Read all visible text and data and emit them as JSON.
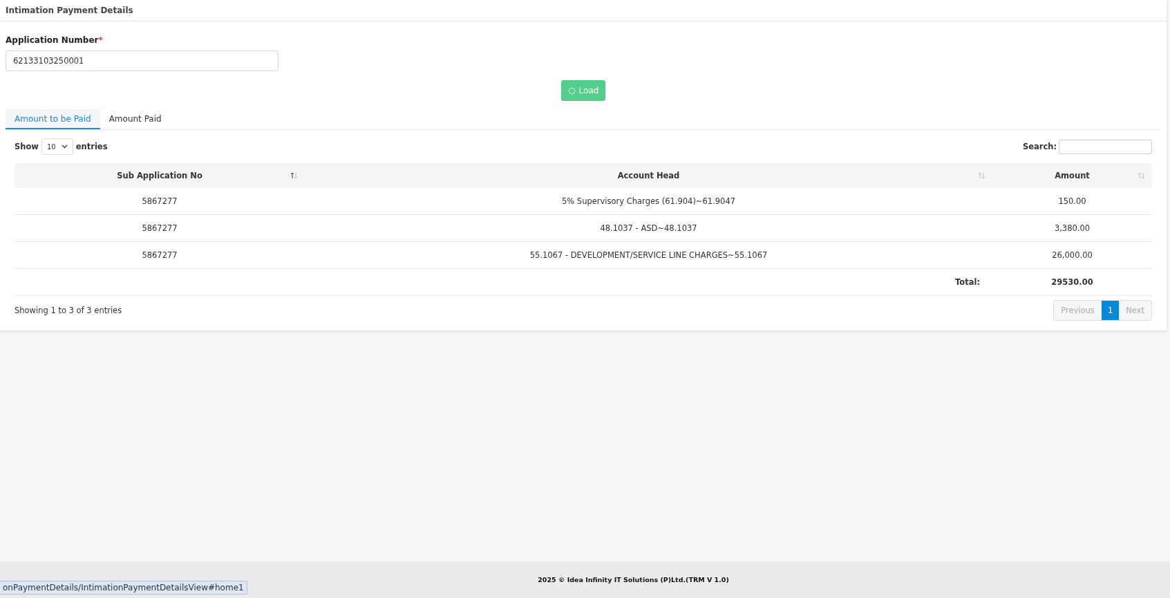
{
  "header": {
    "title": "Intimation Payment Details"
  },
  "form": {
    "label": "Application Number",
    "required_mark": "*",
    "value": "62133103250001"
  },
  "load_button": {
    "label": "Load"
  },
  "tabs": [
    {
      "label": "Amount to be Paid",
      "selected": true
    },
    {
      "label": "Amount Paid",
      "selected": false
    }
  ],
  "table_controls": {
    "show_label": "Show",
    "page_size": "10",
    "entries_label": "entries",
    "search_label": "Search:"
  },
  "table": {
    "columns": [
      {
        "label": "Sub Application No",
        "sorted": true
      },
      {
        "label": "Account Head",
        "sorted": false
      },
      {
        "label": "Amount",
        "sorted": false
      }
    ],
    "rows": [
      [
        "5867277",
        "5% Supervisory Charges (61.904)~61.9047",
        "150.00"
      ],
      [
        "5867277",
        "48.1037 - ASD~48.1037",
        "3,380.00"
      ],
      [
        "5867277",
        "55.1067 - DEVELOPMENT/SERVICE LINE CHARGES~55.1067",
        "26,000.00"
      ]
    ],
    "total_label": "Total:",
    "total_value": "29530.00"
  },
  "info": "Showing 1 to 3 of 3 entries",
  "pagination": [
    {
      "label": "Previous",
      "kind": "nav",
      "disabled": true,
      "selected": false
    },
    {
      "label": "1",
      "kind": "page",
      "disabled": false,
      "selected": true
    },
    {
      "label": "Next",
      "kind": "nav",
      "disabled": true,
      "selected": false
    }
  ],
  "footer": "2025 © Idea Infinity IT Solutions (P)Ltd.(TRM V 1.0)",
  "status_url": "onPaymentDetails/IntimationPaymentDetailsView#home1"
}
